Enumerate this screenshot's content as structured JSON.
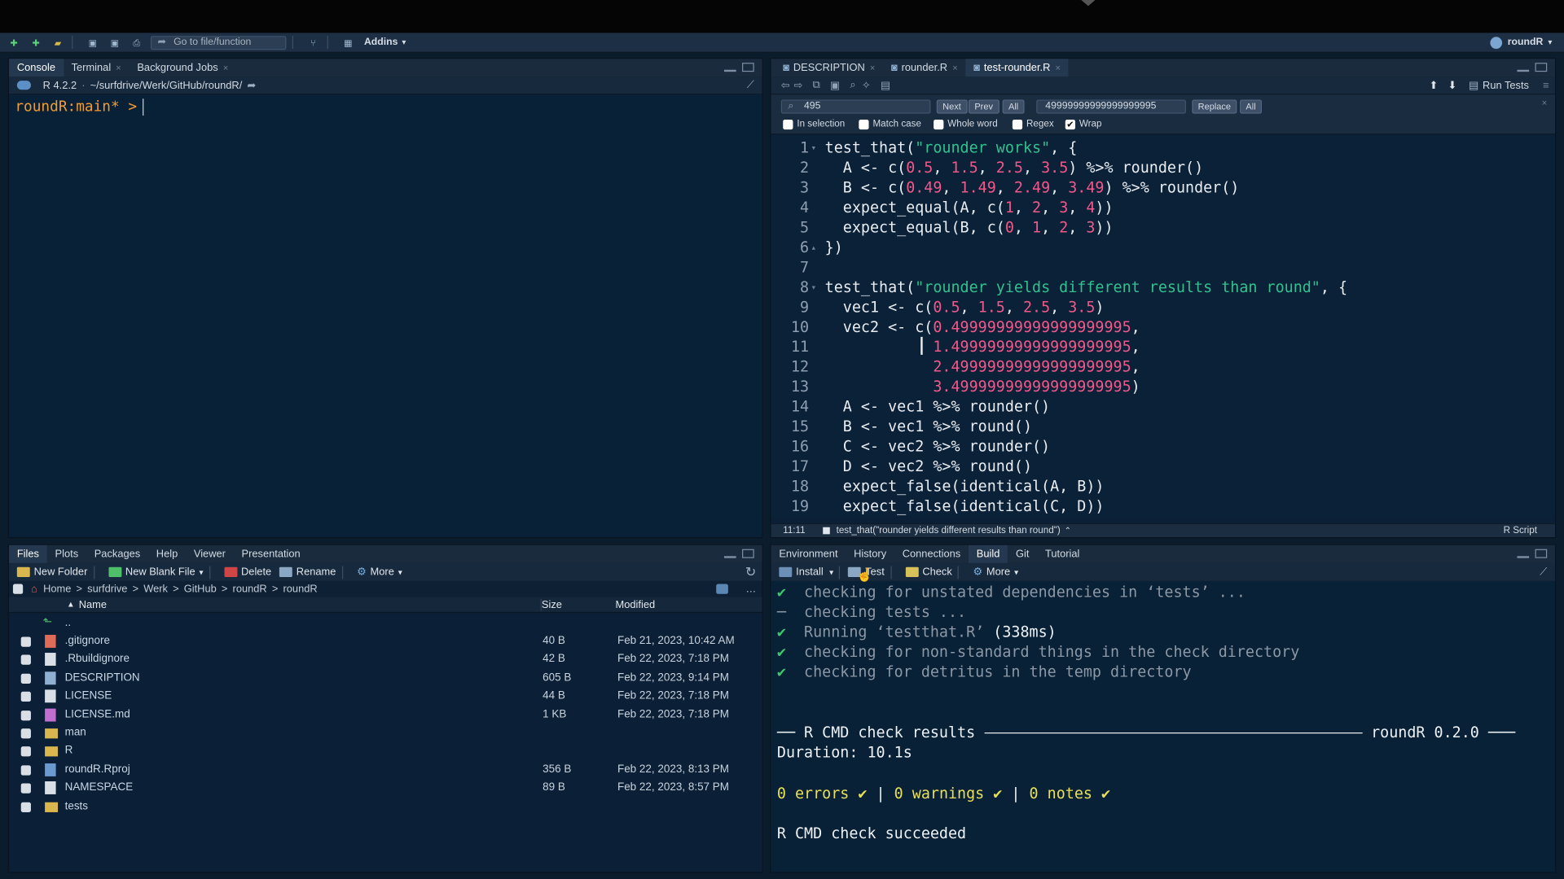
{
  "toolbar": {
    "goto_placeholder": "Go to file/function",
    "addins_label": "Addins",
    "project_label": "roundR"
  },
  "console_pane": {
    "tabs": [
      {
        "label": "Console"
      },
      {
        "label": "Terminal"
      },
      {
        "label": "Background Jobs"
      }
    ],
    "r_version": "R 4.2.2",
    "working_dir": "~/surfdrive/Werk/GitHub/roundR/",
    "prompt": "roundR:main* >"
  },
  "editor_pane": {
    "tabs": [
      {
        "label": "DESCRIPTION"
      },
      {
        "label": "rounder.R"
      },
      {
        "label": "test-rounder.R"
      }
    ],
    "run_tests_label": "Run Tests",
    "find": {
      "search_value": "495",
      "next_label": "Next",
      "prev_label": "Prev",
      "all_label": "All",
      "replace_value": "49999999999999999995",
      "replace_label": "Replace",
      "replace_all_label": "All",
      "options": [
        {
          "label": "In selection",
          "checked": false
        },
        {
          "label": "Match case",
          "checked": false
        },
        {
          "label": "Whole word",
          "checked": false
        },
        {
          "label": "Regex",
          "checked": false
        },
        {
          "label": "Wrap",
          "checked": true
        }
      ]
    },
    "line_numbers": [
      "1",
      "2",
      "3",
      "4",
      "5",
      "6",
      "7",
      "8",
      "9",
      "10",
      "11",
      "12",
      "13",
      "14",
      "15",
      "16",
      "17",
      "18",
      "19"
    ],
    "status": {
      "cursor": "11:11",
      "scope": "test_that(\"rounder yields different results than round\")",
      "file_type": "R Script"
    }
  },
  "files_pane": {
    "tabs": [
      {
        "label": "Files"
      },
      {
        "label": "Plots"
      },
      {
        "label": "Packages"
      },
      {
        "label": "Help"
      },
      {
        "label": "Viewer"
      },
      {
        "label": "Presentation"
      }
    ],
    "toolbar": {
      "new_folder": "New Folder",
      "new_blank_file": "New Blank File",
      "delete": "Delete",
      "rename": "Rename",
      "more": "More"
    },
    "breadcrumb": [
      "Home",
      "surfdrive",
      "Werk",
      "GitHub",
      "roundR",
      "roundR"
    ],
    "columns": {
      "name": "Name",
      "size": "Size",
      "modified": "Modified"
    },
    "up_label": "..",
    "files": [
      {
        "name": ".gitignore",
        "size": "40 B",
        "modified": "Feb 21, 2023, 10:42 AM"
      },
      {
        "name": ".Rbuildignore",
        "size": "42 B",
        "modified": "Feb 22, 2023, 7:18 PM"
      },
      {
        "name": "DESCRIPTION",
        "size": "605 B",
        "modified": "Feb 22, 2023, 9:14 PM"
      },
      {
        "name": "LICENSE",
        "size": "44 B",
        "modified": "Feb 22, 2023, 7:18 PM"
      },
      {
        "name": "LICENSE.md",
        "size": "1 KB",
        "modified": "Feb 22, 2023, 7:18 PM"
      },
      {
        "name": "man",
        "size": "",
        "modified": ""
      },
      {
        "name": "R",
        "size": "",
        "modified": ""
      },
      {
        "name": "roundR.Rproj",
        "size": "356 B",
        "modified": "Feb 22, 2023, 8:13 PM"
      },
      {
        "name": "NAMESPACE",
        "size": "89 B",
        "modified": "Feb 22, 2023, 8:57 PM"
      },
      {
        "name": "tests",
        "size": "",
        "modified": ""
      }
    ]
  },
  "build_pane": {
    "tabs": [
      {
        "label": "Environment"
      },
      {
        "label": "History"
      },
      {
        "label": "Connections"
      },
      {
        "label": "Build"
      },
      {
        "label": "Git"
      },
      {
        "label": "Tutorial"
      }
    ],
    "toolbar": {
      "install": "Install",
      "test": "Test",
      "check": "Check",
      "more": "More"
    },
    "log": [
      {
        "mark": "✔",
        "text": "checking for unstated dependencies in ‘tests’ ..."
      },
      {
        "mark": "─",
        "text": "checking tests ..."
      },
      {
        "mark": "✔",
        "text": "Running ‘testthat.R’",
        "extra": "(338ms)"
      },
      {
        "mark": "✔",
        "text": "checking for non-standard things in the check directory"
      },
      {
        "mark": "✔",
        "text": "checking for detritus in the temp directory"
      }
    ],
    "results_header": "R CMD check results",
    "package_version": "roundR 0.2.0",
    "duration": "Duration: 10.1s",
    "summary": {
      "errors": "0 errors ✔",
      "warnings": "0 warnings ✔",
      "notes": "0 notes ✔",
      "separator": "|"
    },
    "final_message": "R CMD check succeeded"
  }
}
